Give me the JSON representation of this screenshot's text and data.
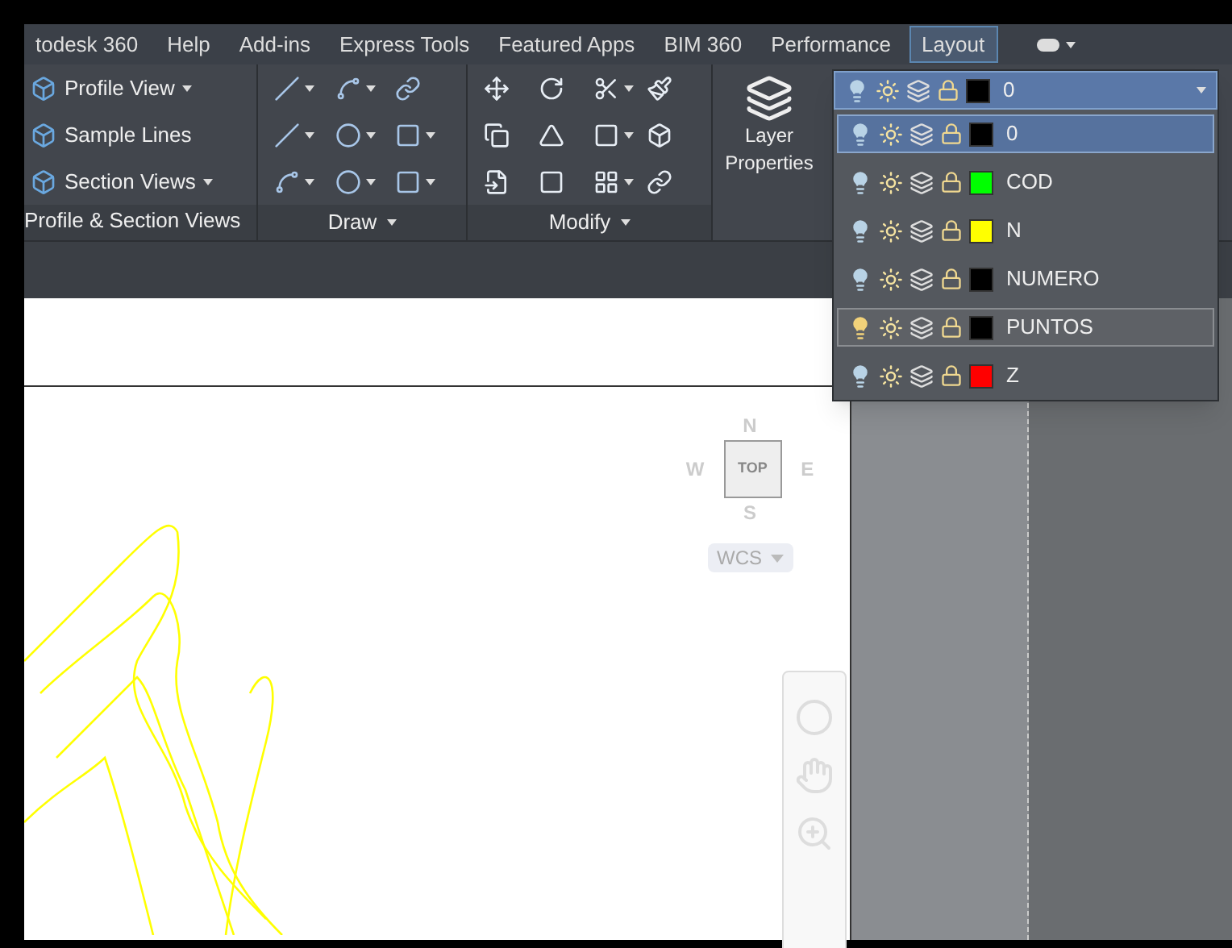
{
  "menu_tabs": [
    {
      "label": "todesk 360",
      "selected": false
    },
    {
      "label": "Help",
      "selected": false
    },
    {
      "label": "Add-ins",
      "selected": false
    },
    {
      "label": "Express Tools",
      "selected": false
    },
    {
      "label": "Featured Apps",
      "selected": false
    },
    {
      "label": "BIM 360",
      "selected": false
    },
    {
      "label": "Performance",
      "selected": false
    },
    {
      "label": "Layout",
      "selected": true
    }
  ],
  "ribbon": {
    "profile_panel": {
      "title": "Profile & Section Views",
      "items": [
        {
          "label": "Profile View",
          "caret": true
        },
        {
          "label": "Sample Lines",
          "caret": false
        },
        {
          "label": "Section Views",
          "caret": true
        }
      ]
    },
    "draw_panel": {
      "title": "Draw",
      "tools": [
        {
          "caret": true
        },
        {
          "caret": true
        },
        {
          "caret": false
        },
        {
          "caret": true
        },
        {
          "caret": true
        },
        {
          "caret": true
        },
        {
          "caret": true
        },
        {
          "caret": true
        },
        {
          "caret": true
        }
      ]
    },
    "modify_panel": {
      "title": "Modify",
      "tools": [
        {
          "caret": false
        },
        {
          "caret": false
        },
        {
          "caret": true
        },
        {
          "caret": false
        },
        {
          "caret": false
        },
        {
          "caret": false
        },
        {
          "caret": true
        },
        {
          "caret": false
        },
        {
          "caret": false
        },
        {
          "caret": false
        },
        {
          "caret": true
        },
        {
          "caret": false
        }
      ]
    },
    "layer_properties": {
      "label": "Layer Properties"
    }
  },
  "layer_dropdown": {
    "current": {
      "name": "0",
      "color": "#000000"
    },
    "layers": [
      {
        "name": "0",
        "color": "#000000",
        "selected": true,
        "hovered": false
      },
      {
        "name": "COD",
        "color": "#00ff00",
        "selected": false,
        "hovered": false
      },
      {
        "name": "N",
        "color": "#ffff00",
        "selected": false,
        "hovered": false
      },
      {
        "name": "NUMERO",
        "color": "#000000",
        "selected": false,
        "hovered": false
      },
      {
        "name": "PUNTOS",
        "color": "#000000",
        "selected": false,
        "hovered": true
      },
      {
        "name": "Z",
        "color": "#ff0000",
        "selected": false,
        "hovered": false
      }
    ]
  },
  "viewcube": {
    "north": "N",
    "south": "S",
    "east": "E",
    "west": "W",
    "face": "TOP",
    "ucs": "WCS"
  }
}
